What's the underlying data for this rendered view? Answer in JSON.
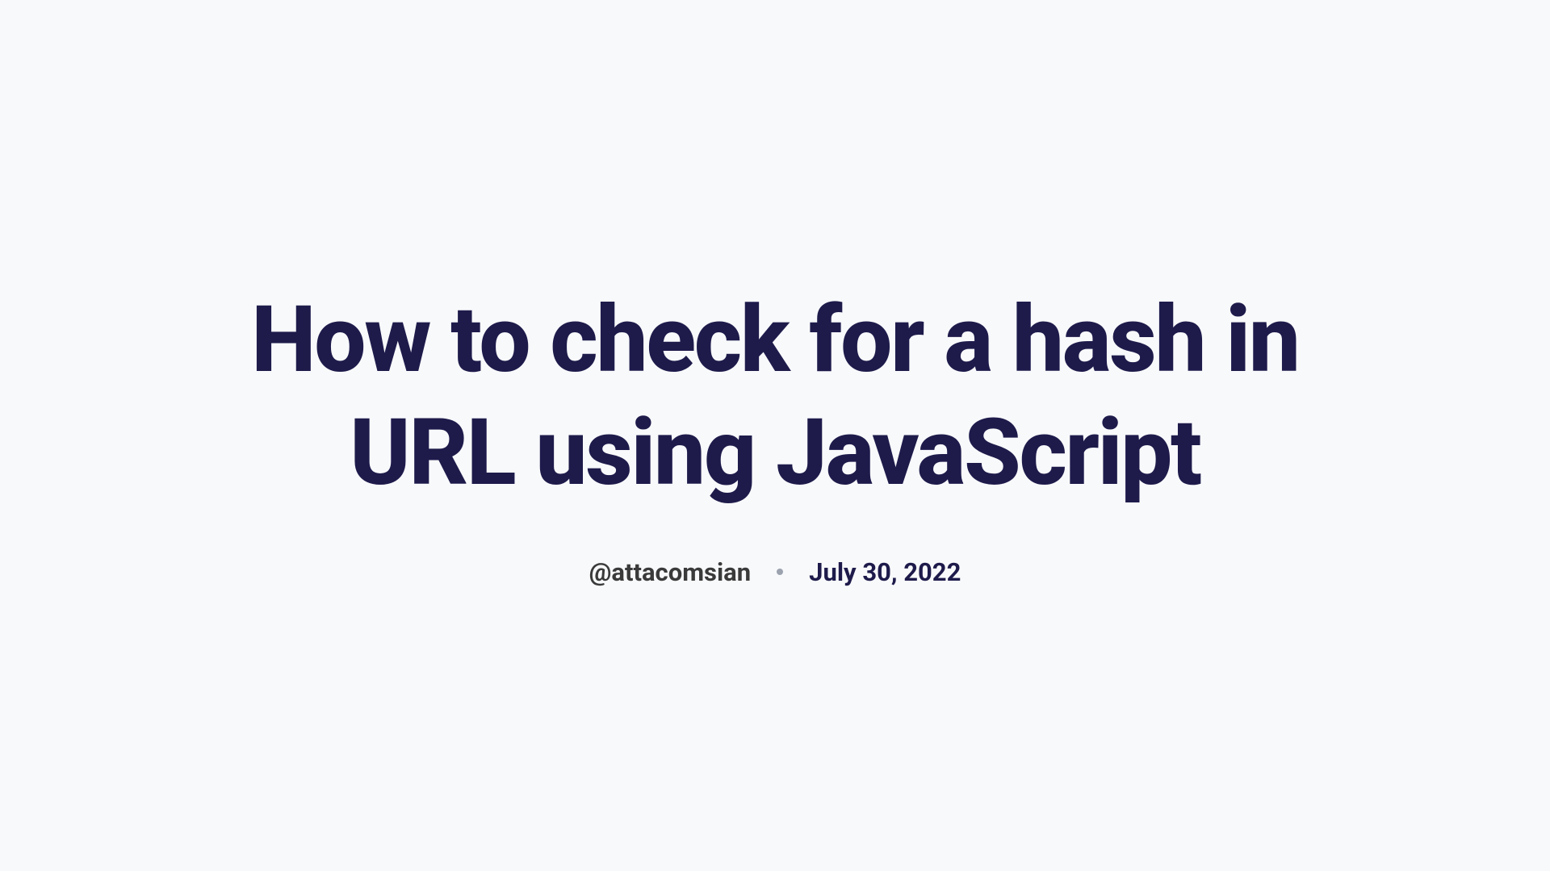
{
  "article": {
    "title": "How to check for a hash in URL using JavaScript",
    "author": "@attacomsian",
    "date": "July 30, 2022"
  }
}
